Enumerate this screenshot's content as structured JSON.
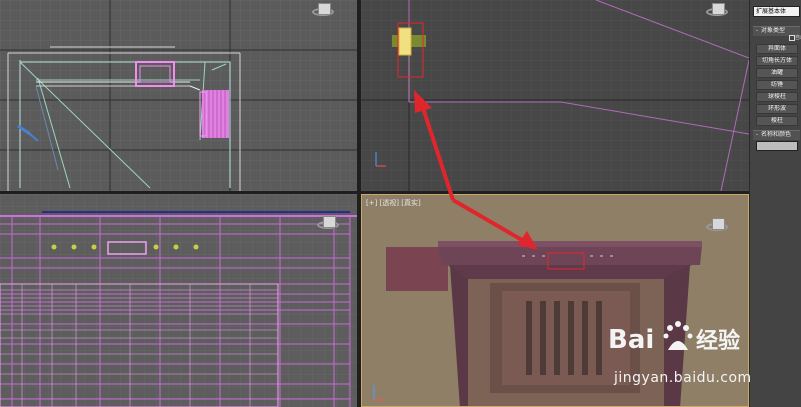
{
  "viewports": {
    "top": {},
    "front": {},
    "left": {},
    "perspective": {
      "label": "[+] [透视] [真实]"
    }
  },
  "command_panel": {
    "category_dropdown": "扩展基本体",
    "object_type_rollout": {
      "sign": "-",
      "title": "对象类型"
    },
    "autogrid_label": "自动栅格",
    "object_buttons": [
      "异面体",
      "切角长方体",
      "油罐",
      "纺锤",
      "球棱柱",
      "环形波",
      "棱柱"
    ],
    "name_color_rollout": {
      "sign": "-",
      "title": "名称和颜色"
    }
  },
  "annotations": {
    "arrow_color": "#e0262d",
    "highlight_color": "#e0262d"
  },
  "colors": {
    "selection_pink": "#f08ef0",
    "viewport_active_border": "#c8a96a",
    "mantel_color": "#6e4457"
  },
  "watermark": {
    "text": "jingyan.baidu.com",
    "logo": "Baidu 经验"
  }
}
